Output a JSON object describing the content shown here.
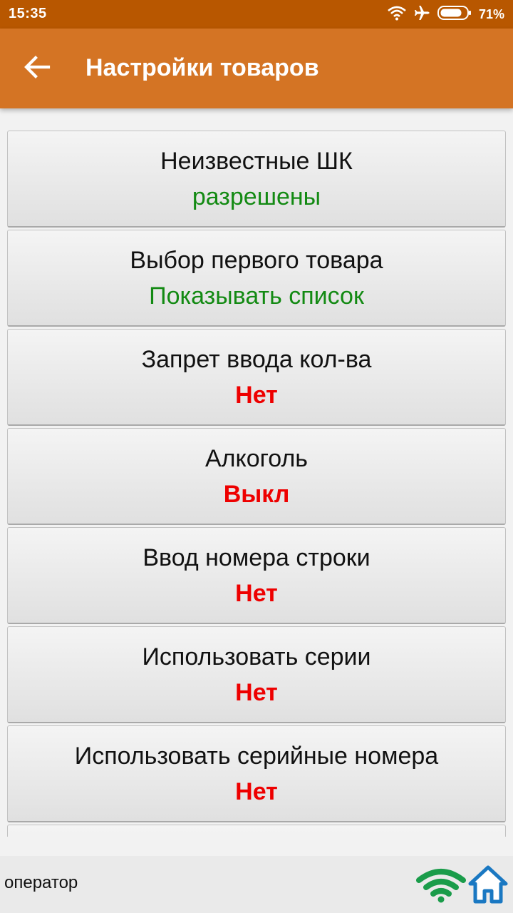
{
  "status_bar": {
    "time": "15:35",
    "battery_percent": "71%",
    "icons": [
      "wifi-icon",
      "airplane-icon",
      "battery-icon"
    ]
  },
  "app_bar": {
    "title": "Настройки товаров",
    "back_icon": "arrow-left-icon"
  },
  "settings": [
    {
      "label": "Неизвестные ШК",
      "value": "разрешены",
      "value_color": "#138a13"
    },
    {
      "label": "Выбор первого товара",
      "value": "Показывать список",
      "value_color": "#138a13"
    },
    {
      "label": "Запрет ввода кол-ва",
      "value": "Нет",
      "value_color": "#ee0000"
    },
    {
      "label": "Алкоголь",
      "value": "Выкл",
      "value_color": "#ee0000"
    },
    {
      "label": "Ввод номера строки",
      "value": "Нет",
      "value_color": "#ee0000"
    },
    {
      "label": "Использовать серии",
      "value": "Нет",
      "value_color": "#ee0000"
    },
    {
      "label": "Использовать серийные номера",
      "value": "Нет",
      "value_color": "#ee0000"
    }
  ],
  "footer": {
    "user": "оператор",
    "icons": [
      "wifi-signal-icon",
      "home-icon"
    ],
    "wifi_color": "#1a9c4a",
    "home_color": "#1a78c2"
  },
  "colors": {
    "status_bar": "#b85700",
    "app_bar": "#d47424",
    "value_positive": "#138a13",
    "value_negative": "#ee0000"
  }
}
